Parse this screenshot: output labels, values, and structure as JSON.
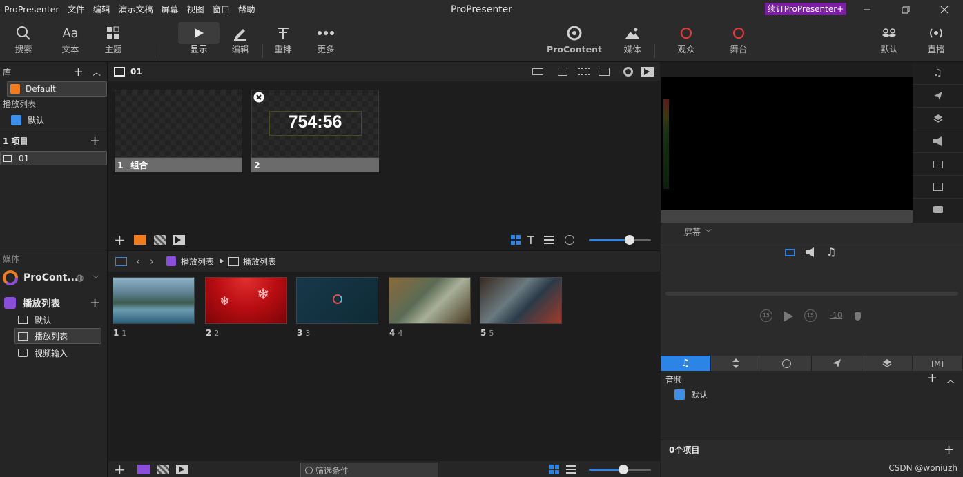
{
  "menu": [
    "ProPresenter",
    "文件",
    "编辑",
    "演示文稿",
    "屏幕",
    "视图",
    "窗口",
    "帮助"
  ],
  "window_title": "ProPresenter",
  "upgrade_label": "续订ProPresenter+",
  "toolbar": {
    "search": "搜索",
    "text": "文本",
    "theme": "主题",
    "show": "显示",
    "edit": "编辑",
    "reflow": "重排",
    "more": "更多",
    "procontent": "ProContent",
    "media": "媒体",
    "audience": "观众",
    "stage": "舞台",
    "default": "默认",
    "live": "直播"
  },
  "left": {
    "library_label": "库",
    "library_item": "Default",
    "playlist_label": "播放列表",
    "playlist_item": "默认",
    "items_label": "1 项目",
    "item_01": "01",
    "media_label": "媒体",
    "procontent_label": "ProCont...",
    "media_playlist_label": "播放列表",
    "media_items": [
      "默认",
      "播放列表",
      "视频输入"
    ]
  },
  "presentation": {
    "name": "01",
    "slides": [
      {
        "number": "1",
        "label": "组合",
        "timer": ""
      },
      {
        "number": "2",
        "label": "",
        "timer": "754:56"
      }
    ]
  },
  "media_bin": {
    "crumb_1": "播放列表",
    "crumb_2": "播放列表",
    "items": [
      {
        "num": "1",
        "sub": "1"
      },
      {
        "num": "2",
        "sub": "2"
      },
      {
        "num": "3",
        "sub": "3"
      },
      {
        "num": "4",
        "sub": "4"
      },
      {
        "num": "5",
        "sub": "5"
      }
    ],
    "filter_label": "筛选条件"
  },
  "right": {
    "screen_label": "屏幕",
    "skip_back": "-10",
    "audio_label": "音频",
    "audio_item": "默认",
    "count_label": "0个项目",
    "watermark": "CSDN @woniuzh"
  },
  "colors": {
    "accent": "#2b84e6",
    "upgrade": "#7a1fa2",
    "orange": "#f07c1e",
    "purple": "#8a4fd8",
    "record_red": "#e03a3a"
  },
  "zoom_top": 0.66,
  "zoom_bottom": 0.55
}
